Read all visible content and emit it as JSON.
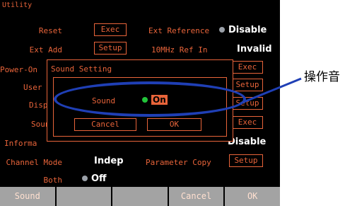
{
  "screen": {
    "title": "Utility",
    "rows": {
      "reset_label": "Reset",
      "reset_button": "Exec",
      "ext_reference_label": "Ext Reference",
      "ext_reference_value": "Disable",
      "ext_add_label": "Ext Add",
      "ext_add_button": "Setup",
      "ref_in_label": "10MHz Ref In",
      "ref_in_value": "Invalid",
      "power_on_label": "Power-On",
      "power_on_button": "Exec",
      "user_label": "User U",
      "user_button": "Setup",
      "display_label": "Displ",
      "display_button": "Setup",
      "sound_label": "Soun",
      "sound_button": "Exec",
      "info_label": "Informa",
      "info_value": "Disable",
      "channel_mode_label": "Channel Mode",
      "channel_mode_value": "Indep",
      "parameter_copy_label": "Parameter Copy",
      "parameter_copy_button": "Setup",
      "both_label": "Both",
      "both_value": "Off"
    },
    "softkeys": [
      "Sound",
      "",
      "",
      "Cancel",
      "OK"
    ]
  },
  "dialog": {
    "title": "Sound Setting",
    "sound_label": "Sound",
    "sound_value": "On",
    "cancel_button": "Cancel",
    "ok_button": "OK"
  },
  "callout": {
    "label": "操作音"
  },
  "colors": {
    "accent": "#e8643a",
    "highlight": "#1f3fb5",
    "on_indicator": "#22c43a",
    "off_indicator": "#9aa0a8",
    "softkey": "#a3a3a3"
  }
}
